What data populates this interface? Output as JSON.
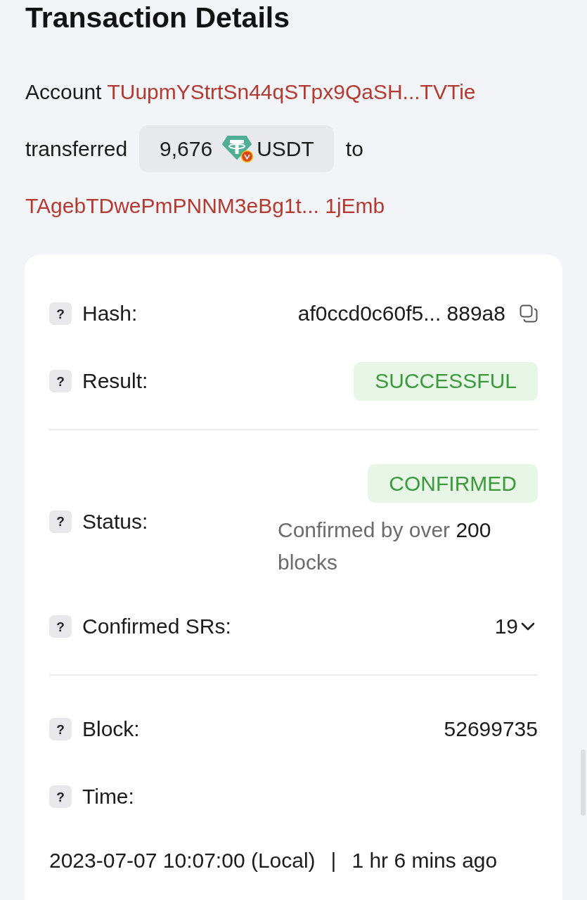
{
  "title": "Transaction Details",
  "summary": {
    "account_label": "Account",
    "from_address": "TUupmYStrtSn44qSTpx9QaSH...TVTie",
    "transferred_label": "transferred",
    "amount": "9,676",
    "token": "USDT",
    "token_verified": true,
    "to_label": "to",
    "to_address": "TAgebTDwePmPNNM3eBg1t... 1jEmb"
  },
  "details": [
    {
      "kind": "hash",
      "hint": "?",
      "label": "Hash:",
      "value": "af0ccd0c60f5... 889a8"
    },
    {
      "kind": "badge",
      "hint": "?",
      "label": "Result:",
      "badge": "SUCCESSFUL"
    },
    {
      "kind": "divider"
    },
    {
      "kind": "status",
      "hint": "?",
      "label": "Status:",
      "badge": "CONFIRMED",
      "note": {
        "prefix": "Confirmed by over",
        "count": "200",
        "suffix": "blocks"
      }
    },
    {
      "kind": "dropdown",
      "hint": "?",
      "label": "Confirmed SRs:",
      "value": "19",
      "expanded": false
    },
    {
      "kind": "divider"
    },
    {
      "kind": "text",
      "hint": "?",
      "label": "Block:",
      "value": "52699735"
    },
    {
      "kind": "time",
      "hint": "?",
      "label": "Time:",
      "timestamp": "2023-07-07 10:07:00 (Local)",
      "separator": "|",
      "relative": "1 hr 6 mins ago"
    }
  ]
}
